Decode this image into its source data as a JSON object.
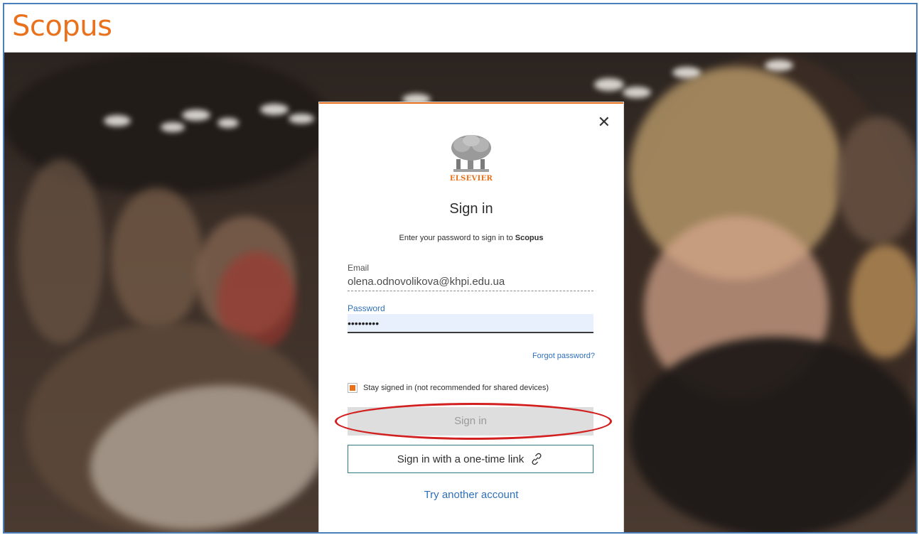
{
  "app": {
    "brand": "Scopus"
  },
  "dialog": {
    "logo_text": "ELSEVIER",
    "title": "Sign in",
    "subtitle_prefix": "Enter your password to sign in to ",
    "subtitle_brand": "Scopus",
    "email_label": "Email",
    "email_value": "olena.odnovolikova@khpi.edu.ua",
    "password_label": "Password",
    "password_value": "•••••••••",
    "forgot_label": "Forgot password?",
    "stay_signed_label": "Stay signed in (not recommended for shared devices)",
    "stay_signed_checked": true,
    "signin_label": "Sign in",
    "one_time_link_label": "Sign in with a one-time link",
    "try_another_label": "Try another account"
  },
  "colors": {
    "brand_orange": "#e9711c",
    "link_blue": "#2e70b8",
    "annotation_red": "#d21f1f"
  },
  "icons": {
    "close": "close-icon",
    "link": "link-icon",
    "checkbox": "checkbox-icon"
  }
}
